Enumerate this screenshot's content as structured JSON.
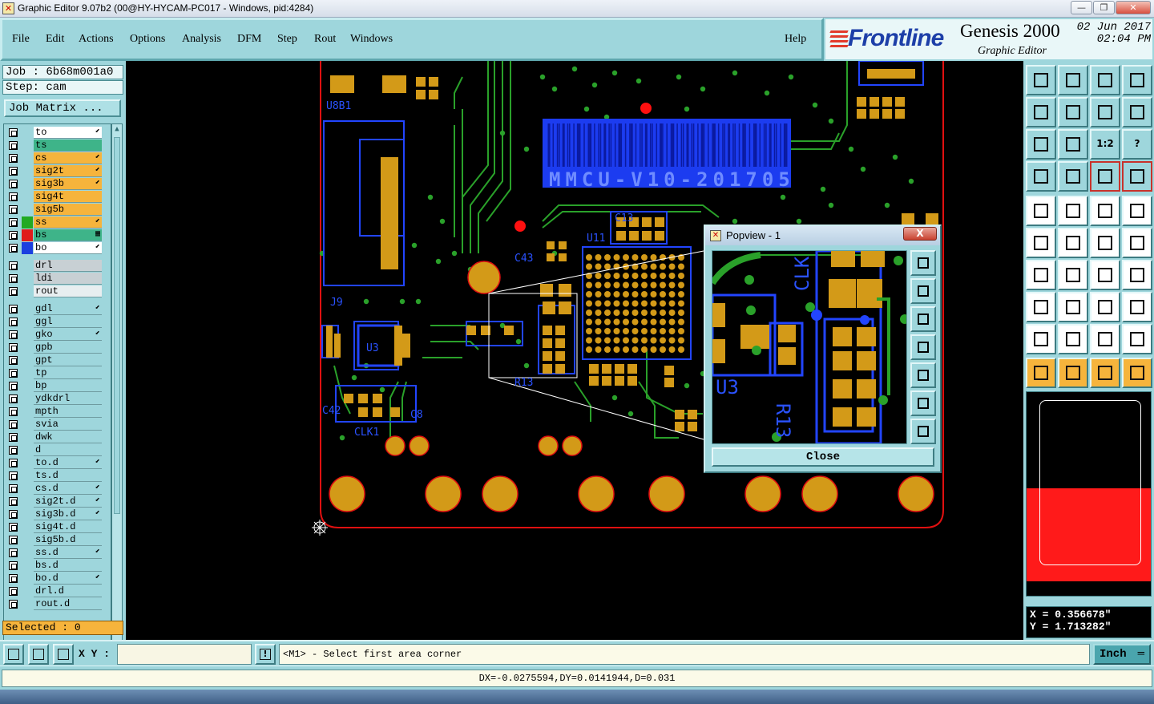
{
  "window": {
    "title": "Graphic Editor 9.07b2 (00@HY-HYCAM-PC017 - Windows, pid:4284)",
    "min": "—",
    "max": "❐",
    "close": "✕"
  },
  "menu": [
    "File",
    "Edit",
    "Actions",
    "Options",
    "Analysis",
    "DFM",
    "Step",
    "Rout",
    "Windows"
  ],
  "help": "Help",
  "brand": {
    "logo": "Frontline",
    "product": "Genesis 2000",
    "subtitle": "Graphic Editor",
    "date": "02 Jun 2017",
    "time": "02:04 PM"
  },
  "job": {
    "job_line": "Job : 6b68m001a0",
    "step_line": "Step: cam",
    "matrix_button": "Job Matrix ..."
  },
  "layers_group1": [
    {
      "name": "to",
      "color": "#ffffff",
      "swatch": "",
      "mark": "⬋"
    },
    {
      "name": "ts",
      "color": "#3eb489",
      "swatch": "",
      "mark": ""
    },
    {
      "name": "cs",
      "color": "#f6b43c",
      "swatch": "",
      "mark": "⬋"
    },
    {
      "name": "sig2t",
      "color": "#f6b43c",
      "swatch": "",
      "mark": "⬋"
    },
    {
      "name": "sig3b",
      "color": "#f6b43c",
      "swatch": "",
      "mark": "⬋"
    },
    {
      "name": "sig4t",
      "color": "#f6b43c",
      "swatch": "",
      "mark": ""
    },
    {
      "name": "sig5b",
      "color": "#f6b43c",
      "swatch": "",
      "mark": ""
    },
    {
      "name": "ss",
      "color": "#f6b43c",
      "swatch": "#22aa22",
      "mark": "⬋"
    },
    {
      "name": "bs",
      "color": "#3eb489",
      "swatch": "#e01b1b",
      "mark": "▦"
    },
    {
      "name": "bo",
      "color": "#ffffff",
      "swatch": "#1b3fe0",
      "mark": "⬋"
    }
  ],
  "layers_group2": [
    {
      "name": "drl",
      "color": "#c8d0d4",
      "mark": ""
    },
    {
      "name": "ldi",
      "color": "#c8d0d4",
      "mark": ""
    },
    {
      "name": "rout",
      "color": "#e8eef0",
      "mark": ""
    }
  ],
  "layers_group3": [
    {
      "name": "gdl",
      "mark": "⬋"
    },
    {
      "name": "ggl",
      "mark": ""
    },
    {
      "name": "gko",
      "mark": "⬋"
    },
    {
      "name": "gpb",
      "mark": ""
    },
    {
      "name": "gpt",
      "mark": ""
    },
    {
      "name": "tp",
      "mark": ""
    },
    {
      "name": "bp",
      "mark": ""
    },
    {
      "name": "ydkdrl",
      "mark": ""
    },
    {
      "name": "mpth",
      "mark": ""
    },
    {
      "name": "svia",
      "mark": ""
    },
    {
      "name": "dwk",
      "mark": ""
    },
    {
      "name": "d",
      "mark": ""
    },
    {
      "name": "to.d",
      "mark": "⬋"
    },
    {
      "name": "ts.d",
      "mark": ""
    },
    {
      "name": "cs.d",
      "mark": "⬋"
    },
    {
      "name": "sig2t.d",
      "mark": "⬋"
    },
    {
      "name": "sig3b.d",
      "mark": "⬋"
    },
    {
      "name": "sig4t.d",
      "mark": ""
    },
    {
      "name": "sig5b.d",
      "mark": ""
    },
    {
      "name": "ss.d",
      "mark": "⬋"
    },
    {
      "name": "bs.d",
      "mark": ""
    },
    {
      "name": "bo.d",
      "mark": "⬋"
    },
    {
      "name": "drl.d",
      "mark": ""
    },
    {
      "name": "rout.d",
      "mark": ""
    }
  ],
  "selected": "Selected : 0",
  "board": {
    "silk_text": "MMCU-V10-201705",
    "labels": {
      "u8": "U8B1",
      "j9": "J9",
      "clk1": "CLK1",
      "r13": "R13",
      "u3": "U3",
      "c42": "C42",
      "c13": "C13",
      "u11": "U11",
      "c43": "C43",
      "c8": "C8"
    }
  },
  "popview": {
    "title": "Popview - 1",
    "close_x": "X",
    "close_button": "Close",
    "labels": {
      "clk": "CLK",
      "r13": "R13",
      "u3": "U3"
    }
  },
  "coords": {
    "x": "X = 0.356678\"",
    "y": "Y = 1.713282\""
  },
  "cmd": {
    "xy_label": "X Y :",
    "xy_value": "",
    "prompt": "<M1> - Select first area corner",
    "unit": "Inch"
  },
  "status": "DX=-0.0275594,DY=0.0141944,D=0.031",
  "tools_text": {
    "one_to_two": "1:2",
    "help_q": "?"
  }
}
